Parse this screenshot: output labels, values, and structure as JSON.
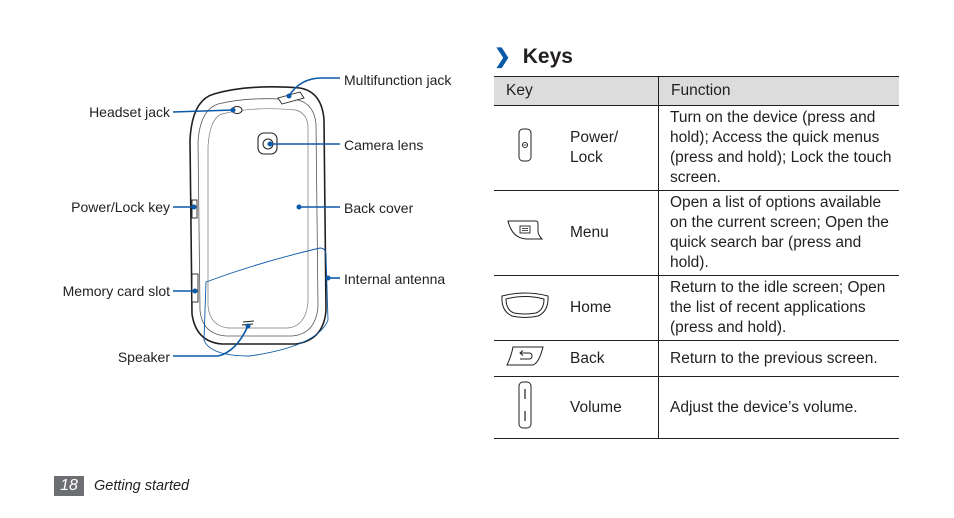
{
  "diagram": {
    "callouts": {
      "headset_jack": "Headset jack",
      "multifunction_jack": "Multifunction jack",
      "camera_lens": "Camera lens",
      "power_lock_key": "Power/Lock key",
      "back_cover": "Back cover",
      "memory_card_slot": "Memory card slot",
      "internal_antenna": "Internal antenna",
      "speaker": "Speaker"
    },
    "accent_color": "#0b5aa8"
  },
  "section": {
    "icon": "chevron-right-icon",
    "title": "Keys"
  },
  "table": {
    "headers": {
      "key": "Key",
      "function": "Function"
    },
    "rows": [
      {
        "icon": "power-lock-key-icon",
        "key": "Power/\nLock",
        "key_line1": "Power/",
        "key_line2": "Lock",
        "function": "Turn on the device (press and hold); Access the quick menus (press and hold); Lock the touch screen."
      },
      {
        "icon": "menu-key-icon",
        "key": "Menu",
        "function": "Open a list of options available on the current screen; Open the quick search bar (press and hold)."
      },
      {
        "icon": "home-key-icon",
        "key": "Home",
        "function": "Return to the idle screen; Open the list of recent applications (press and hold)."
      },
      {
        "icon": "back-key-icon",
        "key": "Back",
        "function": "Return to the previous screen."
      },
      {
        "icon": "volume-key-icon",
        "key": "Volume",
        "function": "Adjust the device’s volume."
      }
    ]
  },
  "footer": {
    "page_number": "18",
    "section_label": "Getting started"
  }
}
